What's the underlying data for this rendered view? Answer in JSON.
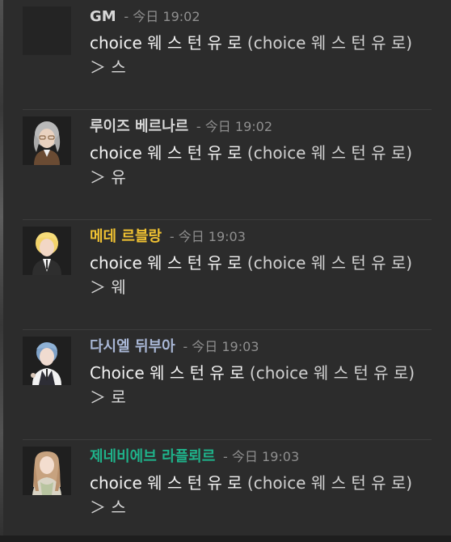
{
  "chat": {
    "messages": [
      {
        "name": "GM",
        "name_color": "#d8d8d8",
        "time_sep": "-",
        "time_day": "今日",
        "time_clock": "19:02",
        "line1_main": "choice 웨 스 턴 유 로 ",
        "line1_aside": "(choice 웨 스 턴 유 로)",
        "line2": "＞ 스"
      },
      {
        "name": "루이즈 베르나르",
        "name_color": "#d8d8d8",
        "time_sep": "-",
        "time_day": "今日",
        "time_clock": "19:02",
        "line1_main": "choice 웨 스 턴 유 로 ",
        "line1_aside": "(choice 웨 스 턴 유 로)",
        "line2": "＞ 유"
      },
      {
        "name": "메데 르블랑",
        "name_color": "#f1c232",
        "time_sep": "-",
        "time_day": "今日",
        "time_clock": "19:03",
        "line1_main": "choice 웨 스 턴 유 로 ",
        "line1_aside": "(choice 웨 스 턴 유 로)",
        "line2": "＞ 웨"
      },
      {
        "name": "다시엘 뒤부아",
        "name_color": "#a9b7d6",
        "time_sep": "-",
        "time_day": "今日",
        "time_clock": "19:03",
        "line1_main": "Choice 웨 스 턴 유 로 ",
        "line1_aside": "(choice 웨 스 턴 유 로)",
        "line2": "＞ 로"
      },
      {
        "name": "제네비에브 라플뢰르",
        "name_color": "#1fb28a",
        "time_sep": "-",
        "time_day": "今日",
        "time_clock": "19:03",
        "line1_main": "choice 웨 스 턴 유 로 ",
        "line1_aside": "(choice 웨 스 턴 유 로)",
        "line2": "＞ 스"
      }
    ]
  },
  "avatars": [
    {
      "kind": "blank",
      "icon": "gm-avatar-placeholder"
    },
    {
      "kind": "portrait",
      "icon": "silver-haired-glasses-portrait",
      "hair": "#b9b9b9",
      "accent": "#7a5a3c",
      "skin": "#e9d2c0"
    },
    {
      "kind": "portrait",
      "icon": "blonde-suit-portrait",
      "hair": "#f3d36b",
      "accent": "#3a3a3a",
      "skin": "#f2d7c5"
    },
    {
      "kind": "portrait",
      "icon": "blue-haired-suit-portrait",
      "hair": "#7fa2c9",
      "accent": "#2d2d35",
      "skin": "#f0dbd0"
    },
    {
      "kind": "portrait",
      "icon": "long-haired-lady-portrait",
      "hair": "#c7a27f",
      "accent": "#d9d4c5",
      "skin": "#f3ddcf"
    }
  ]
}
